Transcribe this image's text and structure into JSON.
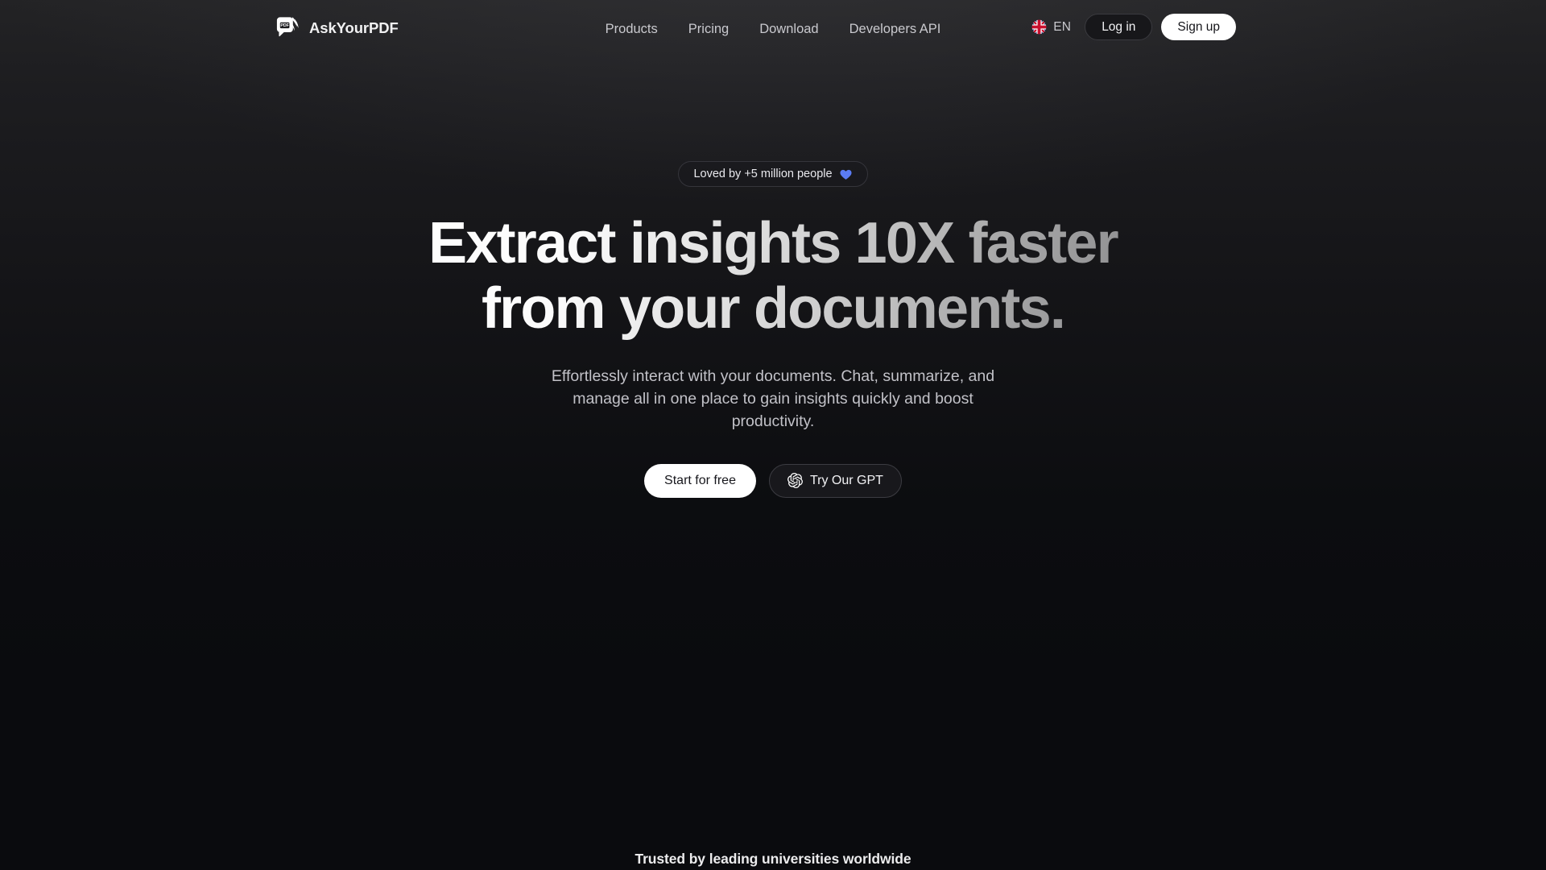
{
  "header": {
    "brand": {
      "name": "AskYourPDF",
      "logo_text": "PDF",
      "icon": "askyourpdf-logo-icon"
    },
    "nav": [
      {
        "label": "Products"
      },
      {
        "label": "Pricing"
      },
      {
        "label": "Download"
      },
      {
        "label": "Developers API"
      }
    ],
    "language": {
      "label": "EN",
      "flag_icon": "uk-flag-icon"
    },
    "login_label": "Log in",
    "signup_label": "Sign up"
  },
  "hero": {
    "badge": {
      "text": "Loved by +5 million people",
      "icon": "heart-icon",
      "icon_color": "#5b7cf5"
    },
    "headline_line1": "Extract insights 10X faster",
    "headline_line2": "from your documents.",
    "subtitle": "Effortlessly interact with your documents. Chat, summarize, and manage all in one place to gain insights quickly and boost productivity.",
    "cta_primary": "Start for free",
    "cta_secondary": "Try Our GPT",
    "cta_secondary_icon": "openai-logo-icon"
  },
  "footer": {
    "trusted_text": "Trusted by leading universities worldwide"
  },
  "colors": {
    "accent_blue": "#5b7cf5",
    "bg_top": "#232325",
    "bg_bottom": "#0a0b0e",
    "text_primary": "#ffffff",
    "text_muted": "#c2c2c8"
  }
}
